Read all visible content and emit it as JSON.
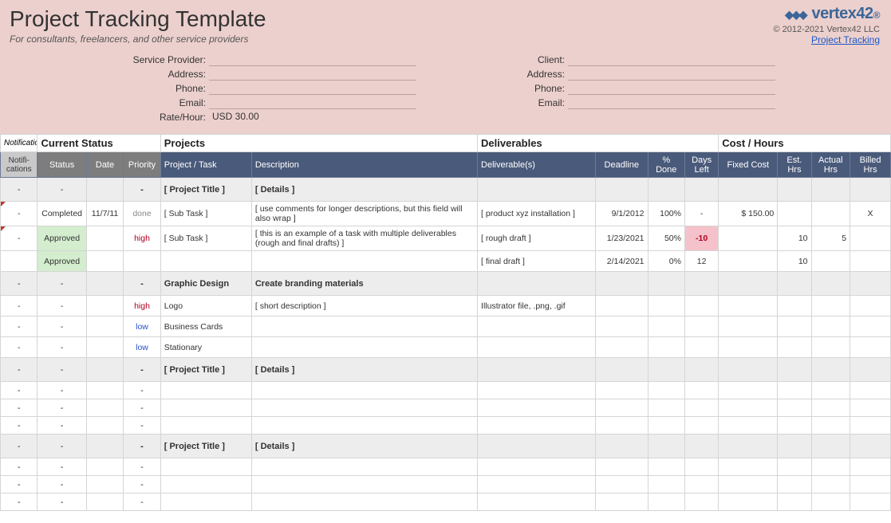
{
  "header": {
    "title": "Project Tracking Template",
    "subtitle": "For consultants, freelancers, and other service providers",
    "brand": "vertex42",
    "copyright": "© 2012-2021 Vertex42 LLC",
    "tracking_link": "Project Tracking"
  },
  "info": {
    "provider": {
      "labels": [
        "Service Provider:",
        "Address:",
        "Phone:",
        "Email:",
        "Rate/Hour:"
      ],
      "values": [
        "",
        "",
        "",
        "",
        "USD 30.00"
      ]
    },
    "client": {
      "labels": [
        "Client:",
        "Address:",
        "Phone:",
        "Email:"
      ],
      "values": [
        "",
        "",
        "",
        ""
      ]
    }
  },
  "group_headers": {
    "notifications": "Notifications",
    "current_status": "Current Status",
    "projects": "Projects",
    "deliverables": "Deliverables",
    "cost_hours": "Cost / Hours"
  },
  "columns": {
    "notifications": "Notifi-\ncations",
    "status": "Status",
    "date": "Date",
    "priority": "Priority",
    "project_task": "Project / Task",
    "description": "Description",
    "deliverables": "Deliverable(s)",
    "deadline": "Deadline",
    "pct_done": "% Done",
    "days_left": "Days Left",
    "fixed_cost": "Fixed Cost",
    "est_hrs": "Est. Hrs",
    "actual_hrs": "Actual Hrs",
    "billed_hrs": "Billed Hrs"
  },
  "rows": [
    {
      "type": "project",
      "notif": "-",
      "status": "-",
      "date": "",
      "priority": "-",
      "task": "[ Project Title ]",
      "desc": "[ Details ]"
    },
    {
      "type": "data",
      "notif": "-",
      "status": "Completed",
      "date": "11/7/11",
      "priority": "done",
      "prio_class": "prio-done",
      "task": "[ Sub Task ]",
      "desc": "[ use comments for longer descriptions, but this field will also wrap ]",
      "deliv": "[ product xyz installation ]",
      "deadline": "9/1/2012",
      "pct": "100%",
      "days": "-",
      "fixed": "$    150.00",
      "est": "",
      "actual": "",
      "billed": "X",
      "red_tri": true
    },
    {
      "type": "data",
      "notif": "-",
      "status": "Approved",
      "status_class": "approved",
      "priority": "high",
      "prio_class": "prio-high",
      "task": "[ Sub Task ]",
      "desc": "[ this is an example of a task with multiple deliverables (rough and final drafts) ]",
      "deliv": "[ rough draft ]",
      "deadline": "1/23/2021",
      "pct": "50%",
      "days": "-10",
      "days_class": "days-neg",
      "est": "10",
      "actual": "5",
      "red_tri": true
    },
    {
      "type": "data",
      "notif": "",
      "status": "Approved",
      "status_class": "approved",
      "priority": "",
      "task": "",
      "desc": "",
      "deliv": "[ final draft ]",
      "deadline": "2/14/2021",
      "pct": "0%",
      "days": "12",
      "est": "10"
    },
    {
      "type": "project",
      "notif": "-",
      "status": "-",
      "priority": "-",
      "task": "Graphic Design",
      "desc": "Create branding materials"
    },
    {
      "type": "data",
      "notif": "-",
      "status": "-",
      "priority": "high",
      "prio_class": "prio-high",
      "task": "Logo",
      "desc": "[ short description ]",
      "deliv": "Illustrator file, .png, .gif"
    },
    {
      "type": "data",
      "notif": "-",
      "status": "-",
      "priority": "low",
      "prio_class": "prio-low",
      "task": "Business Cards"
    },
    {
      "type": "data",
      "notif": "-",
      "status": "-",
      "priority": "low",
      "prio_class": "prio-low",
      "task": "Stationary"
    },
    {
      "type": "project",
      "notif": "-",
      "status": "-",
      "priority": "-",
      "task": "[ Project Title ]",
      "desc": "[ Details ]"
    },
    {
      "type": "empty",
      "notif": "-",
      "status": "-",
      "priority": "-"
    },
    {
      "type": "empty",
      "notif": "-",
      "status": "-",
      "priority": "-"
    },
    {
      "type": "empty",
      "notif": "-",
      "status": "-",
      "priority": "-"
    },
    {
      "type": "project",
      "notif": "-",
      "status": "-",
      "priority": "-",
      "task": "[ Project Title ]",
      "desc": "[ Details ]"
    },
    {
      "type": "empty",
      "notif": "-",
      "status": "-",
      "priority": "-"
    },
    {
      "type": "empty",
      "notif": "-",
      "status": "-",
      "priority": "-"
    },
    {
      "type": "empty",
      "notif": "-",
      "status": "-",
      "priority": "-"
    }
  ]
}
